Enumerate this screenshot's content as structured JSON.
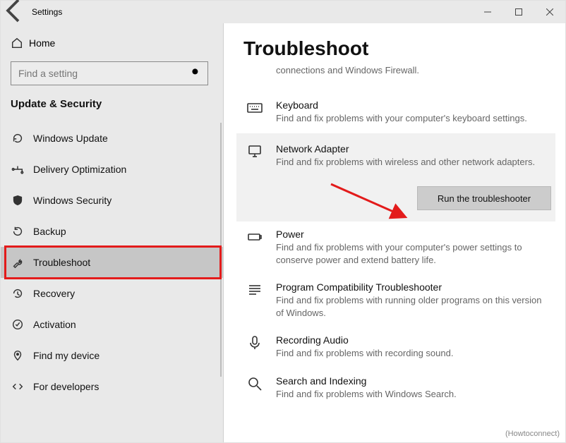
{
  "window": {
    "title": "Settings"
  },
  "sidebar": {
    "home_label": "Home",
    "search_placeholder": "Find a setting",
    "section_title": "Update & Security",
    "items": [
      {
        "label": "Windows Update"
      },
      {
        "label": "Delivery Optimization"
      },
      {
        "label": "Windows Security"
      },
      {
        "label": "Backup"
      },
      {
        "label": "Troubleshoot"
      },
      {
        "label": "Recovery"
      },
      {
        "label": "Activation"
      },
      {
        "label": "Find my device"
      },
      {
        "label": "For developers"
      }
    ]
  },
  "main": {
    "heading": "Troubleshoot",
    "intro_fragment_desc": "connections and Windows Firewall.",
    "items": [
      {
        "title": "Keyboard",
        "desc": "Find and fix problems with your computer's keyboard settings."
      },
      {
        "title": "Network Adapter",
        "desc": "Find and fix problems with wireless and other network adapters.",
        "selected": true
      },
      {
        "title": "Power",
        "desc": "Find and fix problems with your computer's power settings to conserve power and extend battery life."
      },
      {
        "title": "Program Compatibility Troubleshooter",
        "desc": "Find and fix problems with running older programs on this version of Windows."
      },
      {
        "title": "Recording Audio",
        "desc": "Find and fix problems with recording sound."
      },
      {
        "title": "Search and Indexing",
        "desc": "Find and fix problems with Windows Search."
      }
    ],
    "run_button_label": "Run the troubleshooter"
  },
  "watermark": "(Howtoconnect)"
}
